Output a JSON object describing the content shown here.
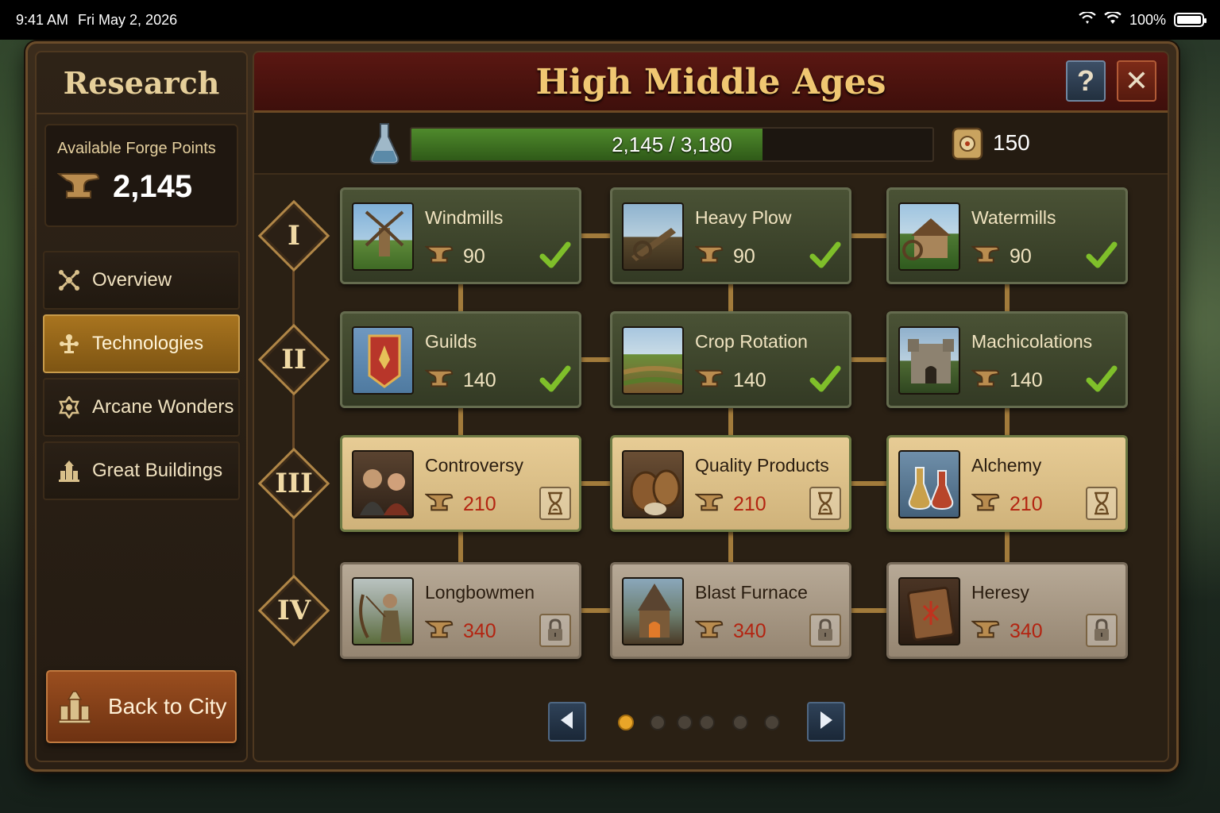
{
  "status_bar": {
    "time": "9:41 AM",
    "date": "Fri May 2, 2026",
    "battery": "100%"
  },
  "sidebar": {
    "title": "Research",
    "forge_points_label": "Available Forge Points",
    "forge_points_value": "2,145",
    "nav": [
      {
        "label": "Overview",
        "icon": "overview-icon",
        "active": false
      },
      {
        "label": "Technologies",
        "icon": "technologies-icon",
        "active": true
      },
      {
        "label": "Arcane Wonders",
        "icon": "arcane-wonders-icon",
        "active": false
      },
      {
        "label": "Great Buildings",
        "icon": "great-buildings-icon",
        "active": false
      }
    ],
    "back_label": "Back to City"
  },
  "header": {
    "title": "High Middle Ages",
    "help_label": "?",
    "close_label": "✕"
  },
  "progress": {
    "text": "2,145 / 3,180",
    "fraction": 0.6745,
    "scrolls": "150"
  },
  "tiers": [
    "I",
    "II",
    "III",
    "IV"
  ],
  "techs": [
    [
      {
        "name": "Windmills",
        "cost": "90",
        "state": "done"
      },
      {
        "name": "Heavy Plow",
        "cost": "90",
        "state": "done"
      },
      {
        "name": "Watermills",
        "cost": "90",
        "state": "done"
      }
    ],
    [
      {
        "name": "Guilds",
        "cost": "140",
        "state": "done"
      },
      {
        "name": "Crop Rotation",
        "cost": "140",
        "state": "done"
      },
      {
        "name": "Machicolations",
        "cost": "140",
        "state": "done"
      }
    ],
    [
      {
        "name": "Controversy",
        "cost": "210",
        "state": "progress"
      },
      {
        "name": "Quality Products",
        "cost": "210",
        "state": "progress"
      },
      {
        "name": "Alchemy",
        "cost": "210",
        "state": "progress"
      }
    ],
    [
      {
        "name": "Longbowmen",
        "cost": "340",
        "state": "locked"
      },
      {
        "name": "Blast Furnace",
        "cost": "340",
        "state": "locked"
      },
      {
        "name": "Heresy",
        "cost": "340",
        "state": "locked"
      }
    ]
  ],
  "pagination": {
    "pages": 6,
    "current": 1
  },
  "colors": {
    "accent_gold": "#e9a528",
    "header_red": "#5a1712",
    "done_green": "#4a5235",
    "cost_red": "#b32411",
    "check_green": "#7fbf2a"
  }
}
